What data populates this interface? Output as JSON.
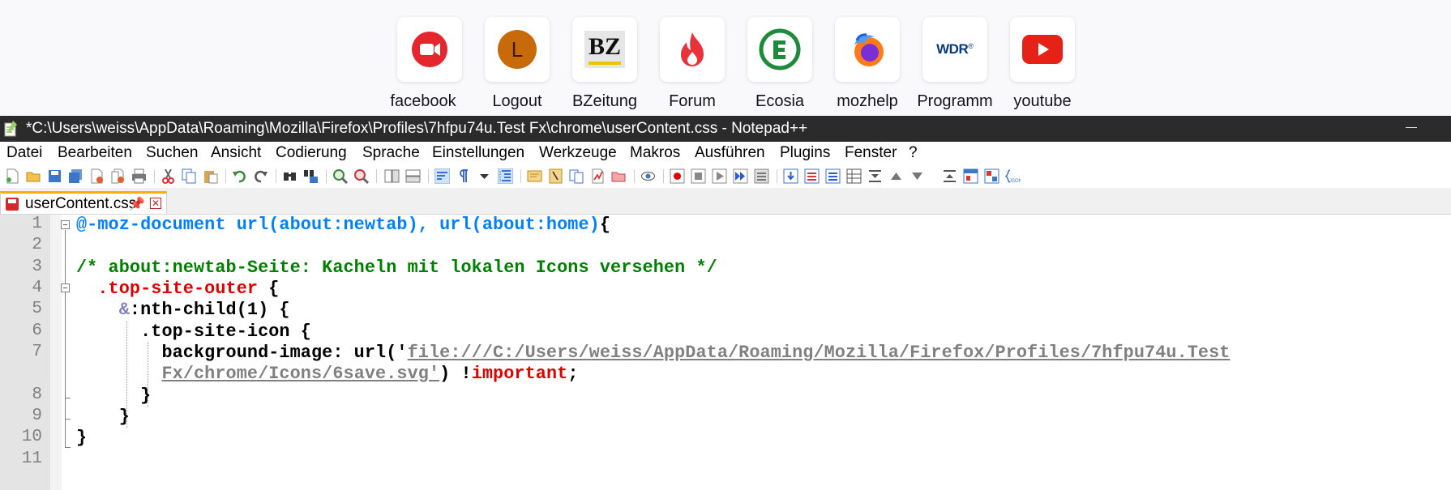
{
  "top_sites": [
    {
      "label": "facebook",
      "icon": "video-camera-icon",
      "color": "#e5262c"
    },
    {
      "label": "Logout",
      "icon": "letter-l-icon",
      "letter": "L",
      "color": "#c8690a"
    },
    {
      "label": "BZeitung",
      "icon": "bz-logo-icon",
      "logo_text": "BZ"
    },
    {
      "label": "Forum",
      "icon": "flame-icon",
      "color": "#e8323c"
    },
    {
      "label": "Ecosia",
      "icon": "ecosia-icon",
      "color": "#1e8a3a"
    },
    {
      "label": "mozhelp",
      "icon": "firefox-icon"
    },
    {
      "label": "Programm",
      "icon": "wdr-logo-icon",
      "logo_text": "WDR"
    },
    {
      "label": "youtube",
      "icon": "play-button-icon",
      "color": "#e62117"
    }
  ],
  "window": {
    "title": "*C:\\Users\\weiss\\AppData\\Roaming\\Mozilla\\Firefox\\Profiles\\7hfpu74u.Test Fx\\chrome\\userContent.css - Notepad++"
  },
  "menu": [
    "Datei",
    "Bearbeiten",
    "Suchen",
    "Ansicht",
    "Codierung",
    "Sprache",
    "Einstellungen",
    "Werkzeuge",
    "Makros",
    "Ausführen",
    "Plugins",
    "Fenster",
    "?"
  ],
  "toolbar_icons": [
    "new-file-icon",
    "open-file-icon",
    "save-icon",
    "save-all-icon",
    "close-icon",
    "close-all-icon",
    "print-icon",
    "cut-icon",
    "copy-icon",
    "paste-icon",
    "undo-icon",
    "redo-icon",
    "find-icon",
    "replace-icon",
    "zoom-in-icon",
    "zoom-out-icon",
    "sync-vertical-icon",
    "sync-horizontal-icon",
    "word-wrap-icon",
    "show-all-chars-icon",
    "dropdown-icon",
    "indent-guide-icon",
    "doc-map-icon",
    "function-list-icon",
    "folder-workspace-icon",
    "monitoring-icon",
    "preview-icon",
    "record-macro-icon",
    "stop-macro-icon",
    "play-macro-icon",
    "run-macro-multiple-icon",
    "save-macro-icon",
    "json-icon"
  ],
  "tab": {
    "label": "userContent.css",
    "pin_glyph": "📌",
    "close_glyph": "✕"
  },
  "editor": {
    "line_numbers": [
      "1",
      "2",
      "3",
      "4",
      "5",
      "6",
      "7",
      "8",
      "9",
      "10",
      "11"
    ],
    "lines": {
      "l1a": "@-moz-document url(about:newtab), url(about:home)",
      "l1b": "{",
      "l3": "/* about:newtab-Seite: Kacheln mit lokalen Icons versehen */",
      "l4a": "  .top-site-outer",
      "l4b": " {",
      "l5a": "    &",
      "l5b": ":nth-child(1) {",
      "l6": "      .top-site-icon {",
      "l7a": "        background-image: url('",
      "l7b": "file:///C:/Users/weiss/AppData/Roaming/Mozilla/Firefox/Profiles/7hfpu74u.Test",
      "l7c_str": "Fx/chrome/Icons/6save.svg'",
      "l7c_rest": ") !",
      "l7c_imp": "important",
      "l7c_end": ";",
      "l8": "      }",
      "l9": "    }",
      "l10": "}"
    }
  }
}
